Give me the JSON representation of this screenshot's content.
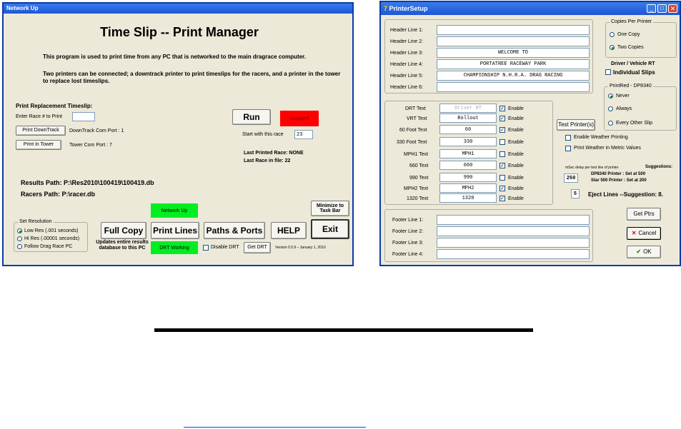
{
  "left_window": {
    "title": "Network Up",
    "heading": "Time Slip -- Print Manager",
    "desc1": "This program is used to print time from any PC that is networked to the main dragrace computer.",
    "desc2": "Two printers can be connected;  a downtrack printer to print timeslips for the racers, and a printer in the tower to replace lost timeslips.",
    "replacement_title": "Print Replacement Timeslip:",
    "enter_race_label": "Enter Race # to Print",
    "enter_race_value": "",
    "print_downtrack": "Print DownTrack",
    "downtrack_port": "DownTrack Com Port : 1",
    "print_tower": "Print in Tower",
    "tower_port": "Tower Com Port : 7",
    "run": "Run",
    "stopped": "Stopped",
    "start_with_label": "Start with this race",
    "start_with_value": "23",
    "last_printed": "Last Printed Race: NONE",
    "last_in_file": "Last Race in file: 22",
    "results_path": "Results Path: P:\\Res2010\\100419\\100419.db",
    "racers_path": "Racers Path:  P:\\racer.db",
    "network_status": "Network Up",
    "minimize": "Minimize to Task Bar",
    "resolution_title": "Set Resolution",
    "res_options": [
      "Low Res (.001 seconds)",
      "Hi Res (.00001 seconds)",
      "Follow Drag Race PC"
    ],
    "full_copy": "Full Copy",
    "full_copy_note": "Updates entire results database to this PC",
    "print_lines": "Print Lines",
    "paths_ports": "Paths & Ports",
    "help": "HELP",
    "exit": "Exit",
    "drt_status": "DRT Working",
    "disable_drt": "Disable DRT",
    "get_drt": "Get DRT",
    "version": "Version 0.5.9 – January 1, 2010"
  },
  "right_window": {
    "title": "PrinterSetup",
    "headers": [
      {
        "label": "Header Line 1:",
        "value": ""
      },
      {
        "label": "Header Line 2:",
        "value": ""
      },
      {
        "label": "Header Line 3:",
        "value": "WELCOME TO"
      },
      {
        "label": "Header Line 4:",
        "value": "PORTATREE RACEWAY PARK"
      },
      {
        "label": "Header Line 5:",
        "value": "CHAMPIONSHIP N.H.R.A. DRAG RACING"
      },
      {
        "label": "Header Line 6:",
        "value": ""
      }
    ],
    "copies_title": "Copies Per Printer",
    "copies_options": [
      "One Copy",
      "Two Copies"
    ],
    "driver_title": "Driver / Vehicle RT",
    "individual_slips": "Individual Slips",
    "fields": [
      {
        "label": "DRT Text",
        "value": "Driver RT",
        "enable": true
      },
      {
        "label": "VRT Text",
        "value": "Rollout",
        "enable": true
      },
      {
        "label": "60 Foot Text",
        "value": "60",
        "enable": true
      },
      {
        "label": "330 Foot Text",
        "value": "330",
        "enable": false
      },
      {
        "label": "MPH1 Text",
        "value": "MPH1",
        "enable": false
      },
      {
        "label": "660 Text",
        "value": "660",
        "enable": true
      },
      {
        "label": "990 Text",
        "value": "990",
        "enable": false
      },
      {
        "label": "MPH2 Text",
        "value": "MPH2",
        "enable": true
      },
      {
        "label": "1320 Text",
        "value": "1320",
        "enable": true
      }
    ],
    "enable_label": "Enable",
    "printred_title": "PrintRed - DP8340",
    "printred_options": [
      "Never",
      "Always",
      "Every Other Slip"
    ],
    "test_printers": "Test Printer(s)",
    "enable_weather": "Enable Weather Printing",
    "weather_metric": "Print Weather in Metric Values",
    "msec_label": "mSec delay per text line of printer",
    "suggestions": "Suggestions:",
    "msec_value": "250",
    "dp_suggest": "DP8340 Printer : Set at 500",
    "star_suggest": "Star 500 Printer : Set at 200",
    "eject_value": "5",
    "eject_label": "Eject Lines --Suggestion: 8.",
    "footers": [
      {
        "label": "Footer Line 1:",
        "value": ""
      },
      {
        "label": "Footer Line 2:",
        "value": ""
      },
      {
        "label": "Footer Line 3:",
        "value": ""
      },
      {
        "label": "Footer Line 4:",
        "value": ""
      }
    ],
    "get_ptrs": "Get Ptrs",
    "cancel": "Cancel",
    "ok": "OK"
  },
  "colors": {
    "stopped": "#ff0000",
    "green": "#00ee22",
    "titlebar": "#1c56d6"
  }
}
